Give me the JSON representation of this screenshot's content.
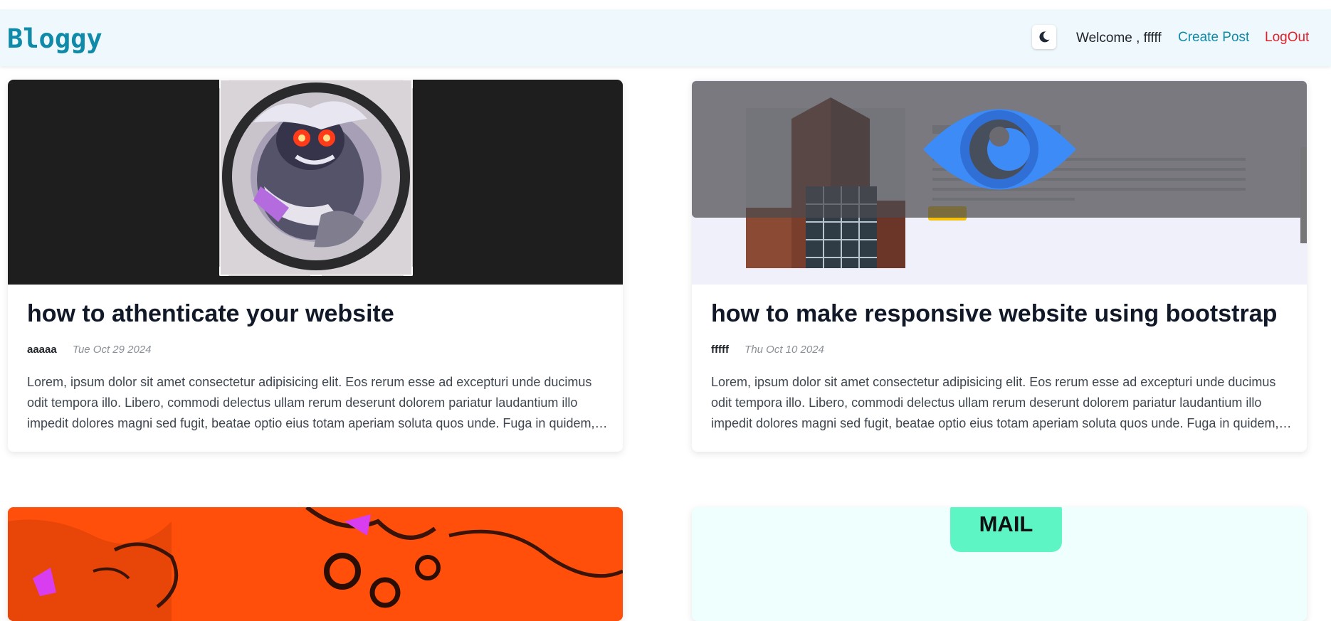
{
  "navbar": {
    "logo": "Bloggy",
    "welcome": "Welcome , fffff",
    "create_post": "Create Post",
    "logout": "LogOut",
    "theme_icon": "moon-icon"
  },
  "posts": [
    {
      "title": "how to athenticate your website",
      "author": "aaaaa",
      "date": "Tue Oct 29 2024",
      "excerpt": "Lorem, ipsum dolor sit amet consectetur adipisicing elit. Eos rerum esse ad excepturi unde ducimus odit tempora illo. Libero, commodi delectus ullam rerum deserunt dolorem pariatur laudantium illo impedit dolores magni sed fugit, beatae optio eius totam aperiam soluta quos unde. Fuga in quidem, eveniet, odio."
    },
    {
      "title": "how to make responsive website using bootstrap",
      "author": "fffff",
      "date": "Thu Oct 10 2024",
      "excerpt": "Lorem, ipsum dolor sit amet consectetur adipisicing elit. Eos rerum esse ad excepturi unde ducimus odit tempora illo. Libero, commodi delectus ullam rerum deserunt dolorem pariatur laudantium illo impedit dolores magni sed fugit, beatae optio eius totam aperiam soluta quos unde. Fuga in quidem, eveniet, odio."
    }
  ],
  "post4": {
    "badge": "MAIL"
  },
  "colors": {
    "brand": "#0f8aa8",
    "logout": "#e0212a",
    "navbar_bg": "#eff8fd"
  }
}
